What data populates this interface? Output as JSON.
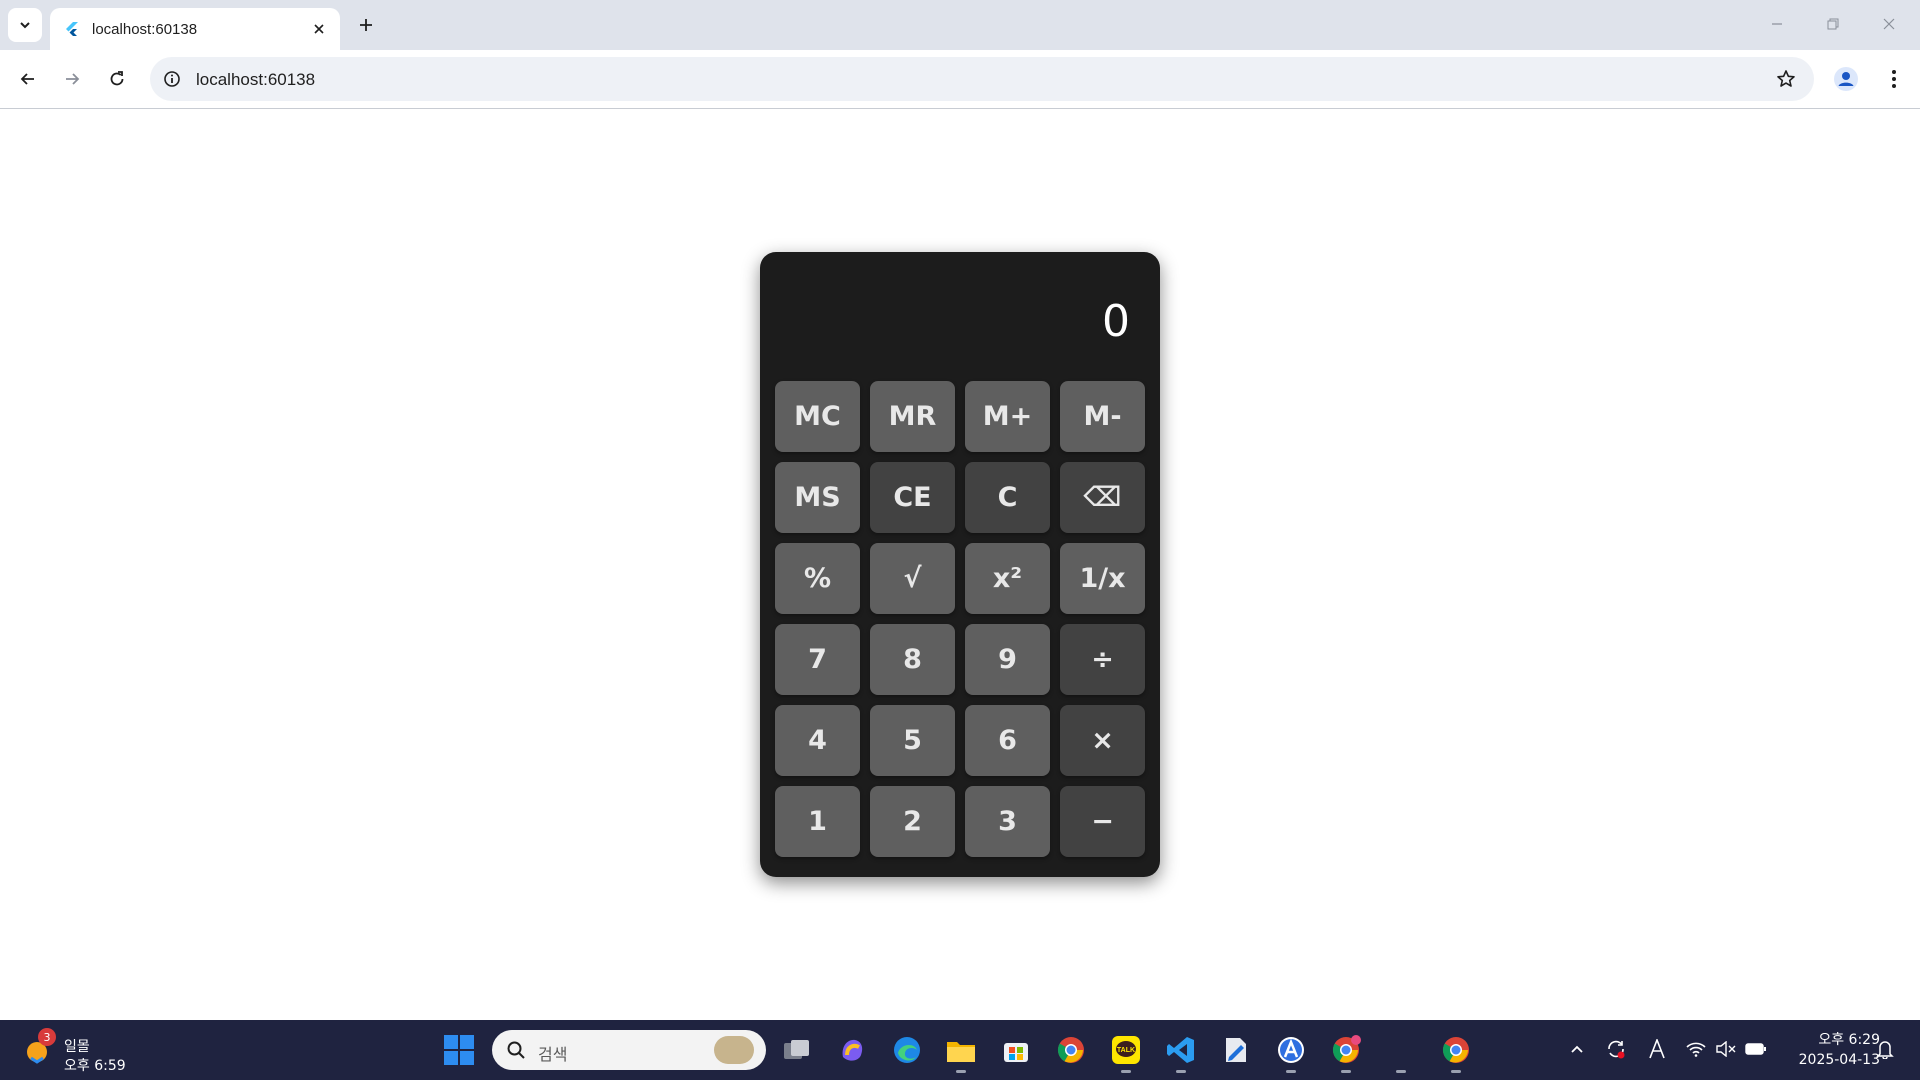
{
  "browser": {
    "tab": {
      "title": "localhost:60138",
      "favicon": "flutter-icon"
    },
    "address": {
      "url": "localhost:60138"
    },
    "icons": {
      "tab_search": "chevron-down-icon",
      "tab_close": "close-icon",
      "new_tab": "plus-icon",
      "back": "arrow-left-icon",
      "forward": "arrow-right-icon",
      "reload": "reload-icon",
      "site_info": "info-icon",
      "bookmark": "star-icon",
      "profile": "profile-icon",
      "menu": "kebab-menu-icon",
      "minimize": "minimize-icon",
      "restore": "restore-icon",
      "close": "close-window-icon"
    }
  },
  "calculator": {
    "display": "0",
    "rows": [
      [
        {
          "label": "MC",
          "tone": "light"
        },
        {
          "label": "MR",
          "tone": "light"
        },
        {
          "label": "M+",
          "tone": "light"
        },
        {
          "label": "M-",
          "tone": "light"
        }
      ],
      [
        {
          "label": "MS",
          "tone": "light"
        },
        {
          "label": "CE",
          "tone": "dark"
        },
        {
          "label": "C",
          "tone": "dark"
        },
        {
          "label": "⌫",
          "tone": "dark"
        }
      ],
      [
        {
          "label": "%",
          "tone": "light"
        },
        {
          "label": "√",
          "tone": "light"
        },
        {
          "label": "x²",
          "tone": "light"
        },
        {
          "label": "1/x",
          "tone": "light"
        }
      ],
      [
        {
          "label": "7",
          "tone": "light"
        },
        {
          "label": "8",
          "tone": "light"
        },
        {
          "label": "9",
          "tone": "light"
        },
        {
          "label": "÷",
          "tone": "dark"
        }
      ],
      [
        {
          "label": "4",
          "tone": "light"
        },
        {
          "label": "5",
          "tone": "light"
        },
        {
          "label": "6",
          "tone": "light"
        },
        {
          "label": "×",
          "tone": "dark"
        }
      ],
      [
        {
          "label": "1",
          "tone": "light"
        },
        {
          "label": "2",
          "tone": "light"
        },
        {
          "label": "3",
          "tone": "light"
        },
        {
          "label": "−",
          "tone": "dark"
        }
      ]
    ],
    "colors": {
      "body": "#1c1c1c",
      "key_light": "#5f5f5f",
      "key_dark": "#424242",
      "text": "#ffffff"
    }
  },
  "taskbar": {
    "weather": {
      "badge": "3",
      "title": "일몰",
      "time": "오후 6:59"
    },
    "search": {
      "placeholder": "검색"
    },
    "apps": [
      "task-view-icon",
      "copilot-icon",
      "edge-icon",
      "file-explorer-icon",
      "microsoft-store-icon",
      "chrome-icon",
      "kakaotalk-icon",
      "vscode-icon",
      "file-editor-icon",
      "app-icon",
      "chrome-profile-icon",
      "chrome-icon"
    ],
    "tray": [
      "chevron-up-icon",
      "sync-icon",
      "ime-icon",
      "wifi-icon",
      "mute-icon",
      "battery-icon"
    ],
    "clock": {
      "time": "오후 6:29",
      "date": "2025-04-13"
    }
  }
}
